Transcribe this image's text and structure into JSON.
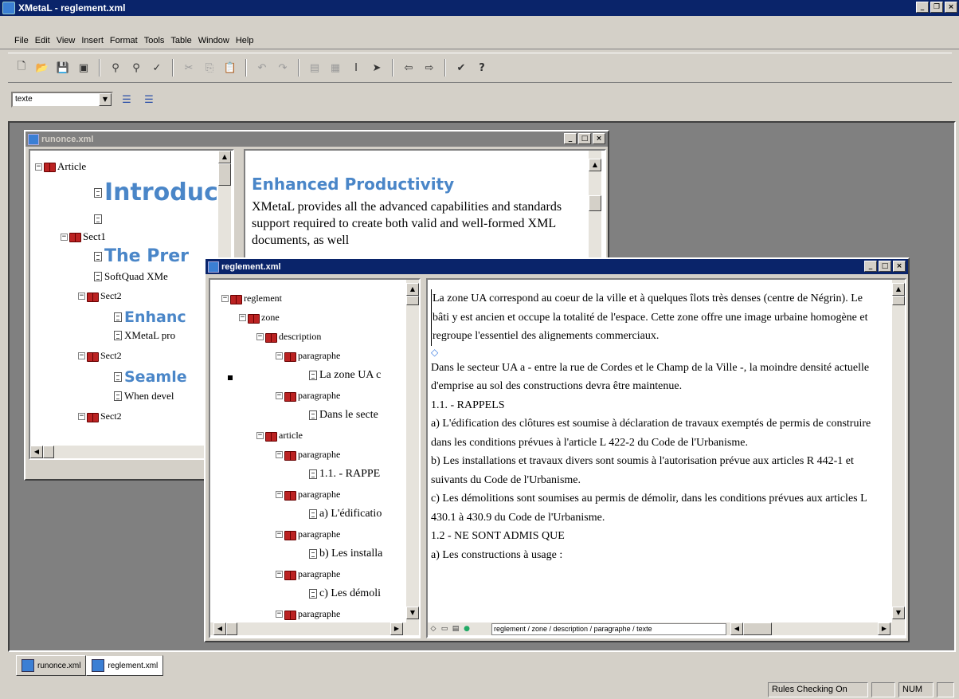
{
  "app": {
    "title": "XMetaL - reglement.xml"
  },
  "menu": [
    "File",
    "Edit",
    "View",
    "Insert",
    "Format",
    "Tools",
    "Table",
    "Window",
    "Help"
  ],
  "toolbar": {
    "element_combo_value": "texte"
  },
  "doc1": {
    "title": "runonce.xml",
    "tree": {
      "article": "Article",
      "intro": "Introduci",
      "sect1": "Sect1",
      "premier": "The Prer",
      "softquad": "SoftQuad XMe",
      "sect2a": "Sect2",
      "enhanc": "Enhanc",
      "xmetal_pro": "XMetaL pro",
      "sect2b": "Sect2",
      "seamle": "Seamle",
      "when_devel": "When devel",
      "sect2c": "Sect2"
    },
    "content": {
      "heading": "Enhanced Productivity",
      "body": "XMetaL provides all the advanced capabilities and standards support required to create both valid and well-formed XML documents, as well"
    }
  },
  "doc2": {
    "title": "reglement.xml",
    "tree": {
      "reglement": "reglement",
      "zone": "zone",
      "description": "description",
      "paragraphe1": "paragraphe",
      "leaf1": "La zone UA c",
      "paragraphe2": "paragraphe",
      "leaf2": "Dans le secte",
      "article": "article",
      "paragraphe3": "paragraphe",
      "leaf3": "1.1. - RAPPE",
      "paragraphe4": "paragraphe",
      "leaf4": "a) L'édificatio",
      "paragraphe5": "paragraphe",
      "leaf5": "b) Les installa",
      "paragraphe6": "paragraphe",
      "leaf6": "c) Les démoli",
      "paragraphe7": "paragraphe"
    },
    "paragraphs": [
      "La zone UA correspond au coeur de la ville et à quelques îlots très denses (centre de Négrin). Le bâti y est ancien et occupe la totalité de l'espace. Cette zone offre une image urbaine homogène et regroupe l'essentiel des alignements commerciaux.",
      "Dans le secteur UA a - entre la rue de Cordes et le Champ de la Ville -, la moindre densité actuelle d'emprise au sol des constructions devra être maintenue.",
      "1.1. - RAPPELS",
      "a) L'édification des clôtures est soumise à déclaration de travaux exemptés de permis de construire dans les conditions prévues à l'article L 422-2 du Code de l'Urbanisme.",
      "b) Les installations et travaux divers sont soumis à l'autorisation prévue aux articles R 442-1 et suivants du Code de l'Urbanisme.",
      "c) Les démolitions sont soumises au permis de démolir, dans les conditions prévues aux articles L 430.1 à 430.9 du Code de l'Urbanisme.",
      "1.2 - NE SONT ADMIS QUE",
      "a) Les constructions à usage :"
    ],
    "element_path": "reglement / zone / description / paragraphe / texte"
  },
  "tabs": [
    "runonce.xml",
    "reglement.xml"
  ],
  "status": {
    "rules": "Rules Checking On",
    "num": "NUM"
  },
  "colors": {
    "titlebar_active": "#0a246a",
    "titlebar_inactive": "#808080",
    "heading_blue": "#4a86c8",
    "book_red": "#b22222"
  }
}
